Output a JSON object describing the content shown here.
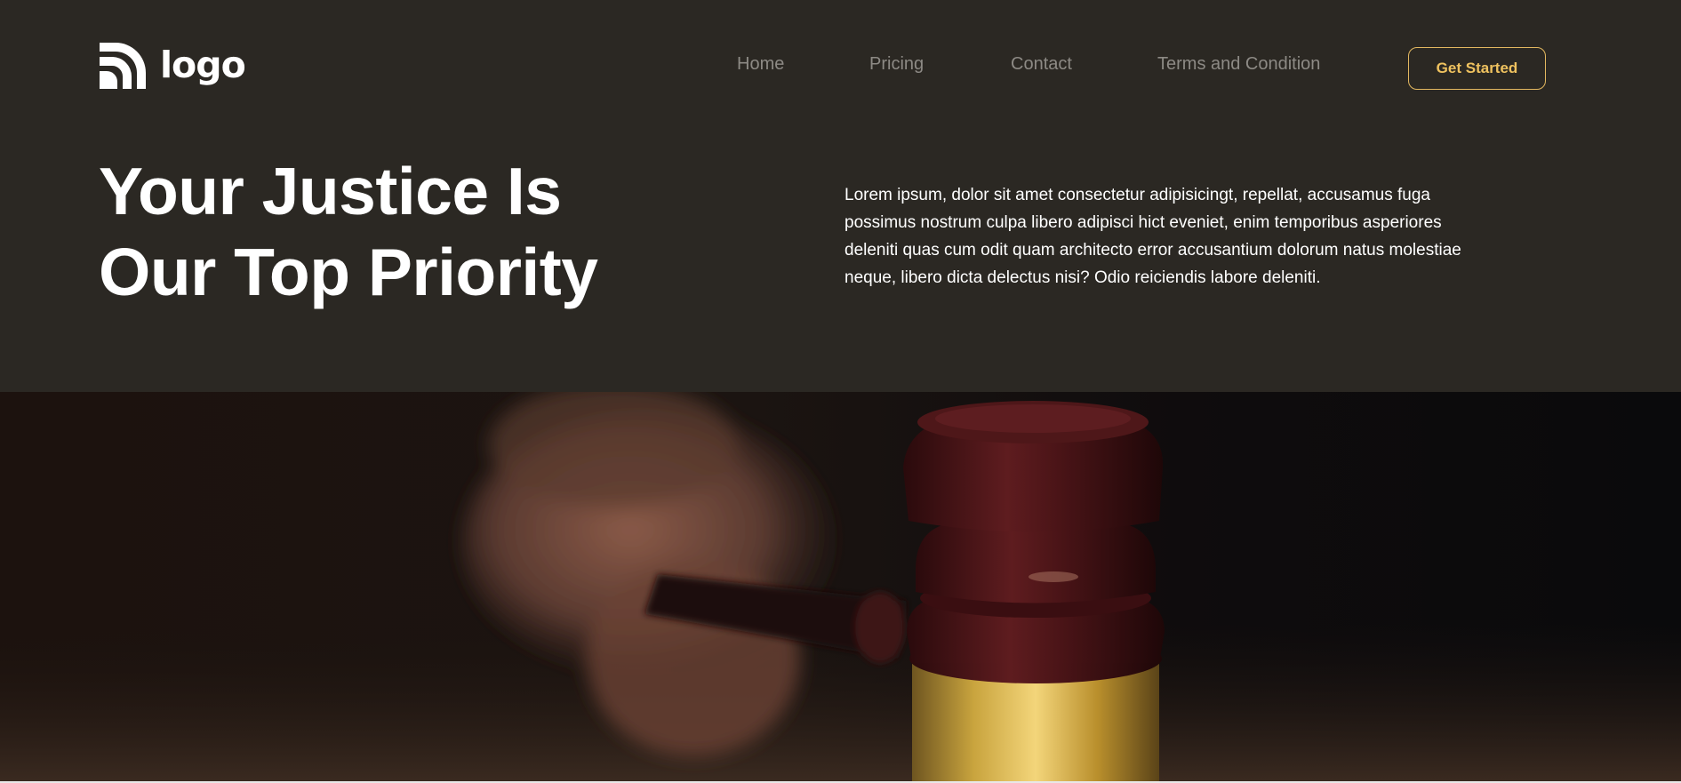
{
  "header": {
    "logo": {
      "icon": "logo-waves-icon",
      "text": "logo"
    },
    "nav": [
      {
        "label": "Home"
      },
      {
        "label": "Pricing"
      },
      {
        "label": "Contact"
      },
      {
        "label": "Terms and Condition"
      }
    ],
    "cta_label": "Get Started"
  },
  "hero": {
    "headline_line1": "Your Justice Is",
    "headline_line2": "Our Top Priority",
    "intro": "Lorem ipsum, dolor sit amet consectetur adipisicingt, repellat, accusamus fuga possimus nostrum culpa libero adipisci hict eveniet, enim temporibus asperiores deleniti quas cum odit quam architecto error accusantium dolorum natus molestiae neque, libero dicta delectus nisi? Odio reiciendis labore deleniti."
  },
  "colors": {
    "header_bg": "#2b2823",
    "accent": "#efc25f",
    "nav_text": "#8d8a85",
    "text_light": "#ffffff"
  }
}
